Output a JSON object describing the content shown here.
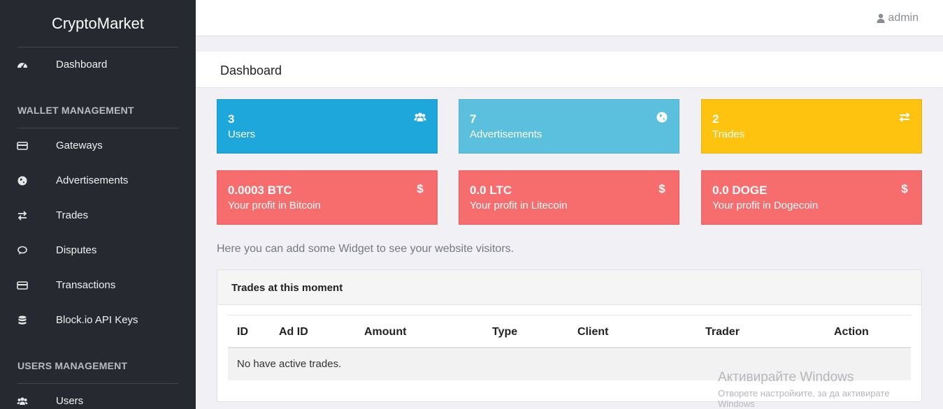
{
  "sidebar": {
    "brand": "CryptoMarket",
    "sections": [
      "WALLET MANAGEMENT",
      "USERS MANAGEMENT"
    ],
    "items": [
      {
        "label": "Dashboard",
        "icon": "dashboard-icon"
      },
      {
        "label": "Gateways",
        "icon": "credit-card-icon"
      },
      {
        "label": "Advertisements",
        "icon": "globe-icon"
      },
      {
        "label": "Trades",
        "icon": "exchange-icon"
      },
      {
        "label": "Disputes",
        "icon": "comment-icon"
      },
      {
        "label": "Transactions",
        "icon": "credit-card-icon"
      },
      {
        "label": "Block.io API Keys",
        "icon": "database-icon"
      },
      {
        "label": "Users",
        "icon": "users-icon"
      }
    ]
  },
  "topbar": {
    "user": "admin",
    "user_icon": "user-icon"
  },
  "page": {
    "title": "Dashboard"
  },
  "stats": [
    {
      "value": "3",
      "label": "Users",
      "icon": "users-icon",
      "color": "#1ea7da"
    },
    {
      "value": "7",
      "label": "Advertisements",
      "icon": "globe-icon",
      "color": "#5bc0de"
    },
    {
      "value": "2",
      "label": "Trades",
      "icon": "exchange-icon",
      "color": "#fdc30f"
    },
    {
      "value": "0.0003 BTC",
      "label": "Your profit in Bitcoin",
      "icon": "dollar-icon",
      "color": "#f76c6c"
    },
    {
      "value": "0.0 LTC",
      "label": "Your profit in Litecoin",
      "icon": "dollar-icon",
      "color": "#f76c6c"
    },
    {
      "value": "0.0 DOGE",
      "label": "Your profit in Dogecoin",
      "icon": "dollar-icon",
      "color": "#f76c6c"
    }
  ],
  "note": "Here you can add some Widget to see your website visitors.",
  "trades_panel": {
    "title": "Trades at this moment",
    "columns": [
      "ID",
      "Ad ID",
      "Amount",
      "Type",
      "Client",
      "Trader",
      "Action"
    ],
    "empty_message": "No have active trades."
  },
  "watermark": {
    "line1": "Активирайте Windows",
    "line2": "Отворете настройките, за да активирате",
    "line3": "Windows"
  }
}
